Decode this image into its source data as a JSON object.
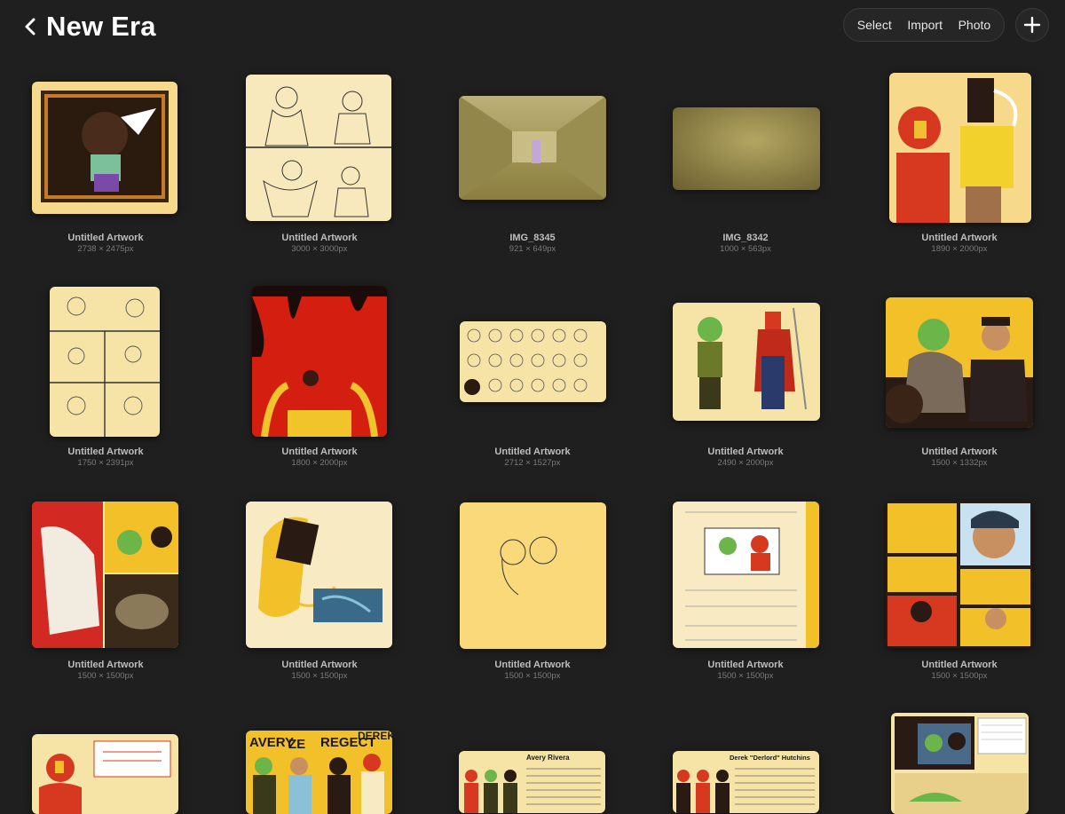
{
  "header": {
    "title": "New Era",
    "select_label": "Select",
    "import_label": "Import",
    "photo_label": "Photo"
  },
  "gallery": [
    {
      "name": "Untitled Artwork",
      "dims": "2738 × 2475px"
    },
    {
      "name": "Untitled Artwork",
      "dims": "3000 × 3000px"
    },
    {
      "name": "IMG_8345",
      "dims": "921 × 649px"
    },
    {
      "name": "IMG_8342",
      "dims": "1000 × 563px"
    },
    {
      "name": "Untitled Artwork",
      "dims": "1890 × 2000px"
    },
    {
      "name": "Untitled Artwork",
      "dims": "1750 × 2391px"
    },
    {
      "name": "Untitled Artwork",
      "dims": "1800 × 2000px"
    },
    {
      "name": "Untitled Artwork",
      "dims": "2712 × 1527px"
    },
    {
      "name": "Untitled Artwork",
      "dims": "2490 × 2000px"
    },
    {
      "name": "Untitled Artwork",
      "dims": "1500 × 1332px"
    },
    {
      "name": "Untitled Artwork",
      "dims": "1500 × 1500px"
    },
    {
      "name": "Untitled Artwork",
      "dims": "1500 × 1500px"
    },
    {
      "name": "Untitled Artwork",
      "dims": "1500 × 1500px"
    },
    {
      "name": "Untitled Artwork",
      "dims": "1500 × 1500px"
    },
    {
      "name": "Untitled Artwork",
      "dims": "1500 × 1500px"
    }
  ],
  "bottom_row_text": {
    "avery": "AVERY",
    "ze": "ZE",
    "regect": "REGECT",
    "derek": "DEREK",
    "avery_rivera": "Avery Rivera",
    "derek_hutchins": "Derek \"Derlord\" Hutchins"
  }
}
